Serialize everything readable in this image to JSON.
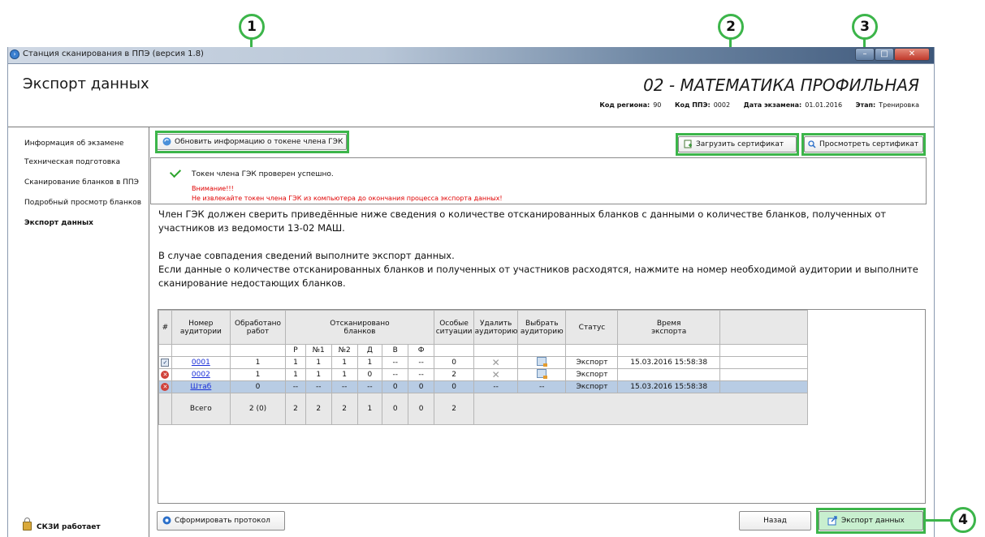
{
  "window": {
    "title": "Станция сканирования в ППЭ (версия 1.8)"
  },
  "header": {
    "page_title": "Экспорт данных",
    "subject": "02 - МАТЕМАТИКА ПРОФИЛЬНАЯ",
    "meta": {
      "region_label": "Код региона:",
      "region_value": "90",
      "ppe_label": "Код ППЭ:",
      "ppe_value": "0002",
      "date_label": "Дата экзамена:",
      "date_value": "01.01.2016",
      "stage_label": "Этап:",
      "stage_value": "Тренировка"
    }
  },
  "sidebar": {
    "items": [
      {
        "label": "Информация об экзамене"
      },
      {
        "label": "Техническая подготовка"
      },
      {
        "label": "Сканирование бланков в ППЭ"
      },
      {
        "label": "Подробный просмотр бланков"
      },
      {
        "label": "Экспорт данных",
        "active": true
      }
    ],
    "status": "СКЗИ работает"
  },
  "toolbar": {
    "refresh_token": "Обновить информацию о токене члена ГЭК",
    "upload_cert": "Загрузить сертификат",
    "view_cert": "Просмотреть сертификат"
  },
  "messages": {
    "ok": "Токен члена ГЭК проверен успешно.",
    "warn_title": "Внимание!!!",
    "warn_text": "Не извлекайте токен члена ГЭК из компьютера до окончания процесса экспорта данных!"
  },
  "instructions": {
    "line1": "Член ГЭК должен сверить приведённые ниже сведения о количестве отсканированных бланков с данными о количестве бланков, полученных от",
    "line2": "участников из ведомости 13-02 МАШ.",
    "line3": "В случае совпадения сведений выполните экспорт данных.",
    "line4": "Если данные о количестве отсканированных бланков и полученных от участников расходятся, нажмите на номер необходимой аудитории и выполните",
    "line5": "сканирование недостающих бланков."
  },
  "table": {
    "headers": {
      "num": "#",
      "room": "Номер аудитории",
      "processed": "Обработано работ",
      "scanned": "Отсканировано бланков",
      "special": "Особые ситуации",
      "delete": "Удалить аудиторию",
      "select": "Выбрать аудиторию",
      "status": "Статус",
      "export_time": "Время экспорта"
    },
    "sub_headers": [
      "Р",
      "№1",
      "№2",
      "Д",
      "В",
      "Ф"
    ],
    "rows": [
      {
        "state": "checked",
        "room": "0001",
        "processed": "1",
        "r": "1",
        "n1": "1",
        "n2": "1",
        "d": "1",
        "v": "--",
        "f": "--",
        "special": "0",
        "status": "Экспорт",
        "time": "15.03.2016 15:58:38",
        "selected": false
      },
      {
        "state": "error",
        "room": "0002",
        "processed": "1",
        "r": "1",
        "n1": "1",
        "n2": "1",
        "d": "0",
        "v": "--",
        "f": "--",
        "special": "2",
        "status": "Экспорт",
        "time": "",
        "selected": false
      },
      {
        "state": "error",
        "room": "Штаб",
        "processed": "0",
        "r": "--",
        "n1": "--",
        "n2": "--",
        "d": "--",
        "v": "0",
        "f": "0",
        "special": "0",
        "delete": "--",
        "pick": "--",
        "status": "Экспорт",
        "time": "15.03.2016 15:58:38",
        "selected": true
      }
    ],
    "total": {
      "label": "Всего",
      "processed": "2 (0)",
      "r": "2",
      "n1": "2",
      "n2": "2",
      "d": "1",
      "v": "0",
      "f": "0",
      "special": "2"
    }
  },
  "footer": {
    "protocol": "Сформировать протокол",
    "back": "Назад",
    "export": "Экспорт данных"
  },
  "callouts": [
    "1",
    "2",
    "3",
    "4"
  ],
  "colors": {
    "highlight": "#3cb54a",
    "selected_row": "#b8cce4",
    "warning": "#e00000",
    "link": "#1a2fd8"
  }
}
